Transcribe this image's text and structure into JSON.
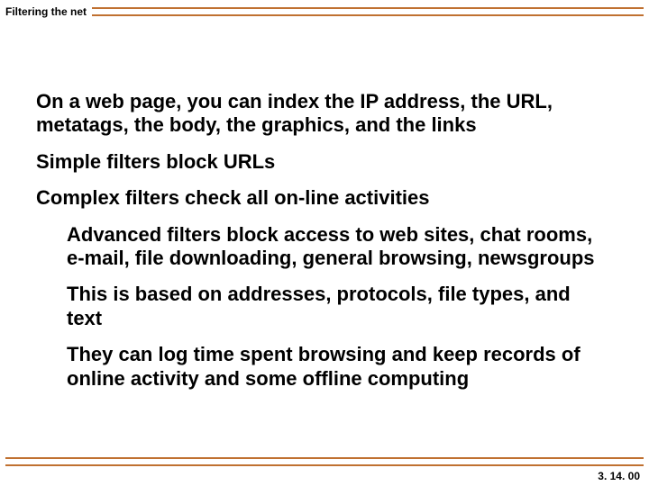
{
  "header": {
    "title": "Filtering the net"
  },
  "body": {
    "p1": "On a web page, you can index the IP address, the URL, metatags, the body, the graphics, and the links",
    "p2": "Simple filters block URLs",
    "p3": "Complex filters check all on-line activities",
    "sub1": "Advanced filters block access to web sites, chat rooms, e-mail, file downloading, general browsing, newsgroups",
    "sub2": "This is based on addresses, protocols, file types, and text",
    "sub3": "They can log time spent browsing and keep records of online activity and some offline computing"
  },
  "footer": {
    "page": "3. 14. 00"
  }
}
